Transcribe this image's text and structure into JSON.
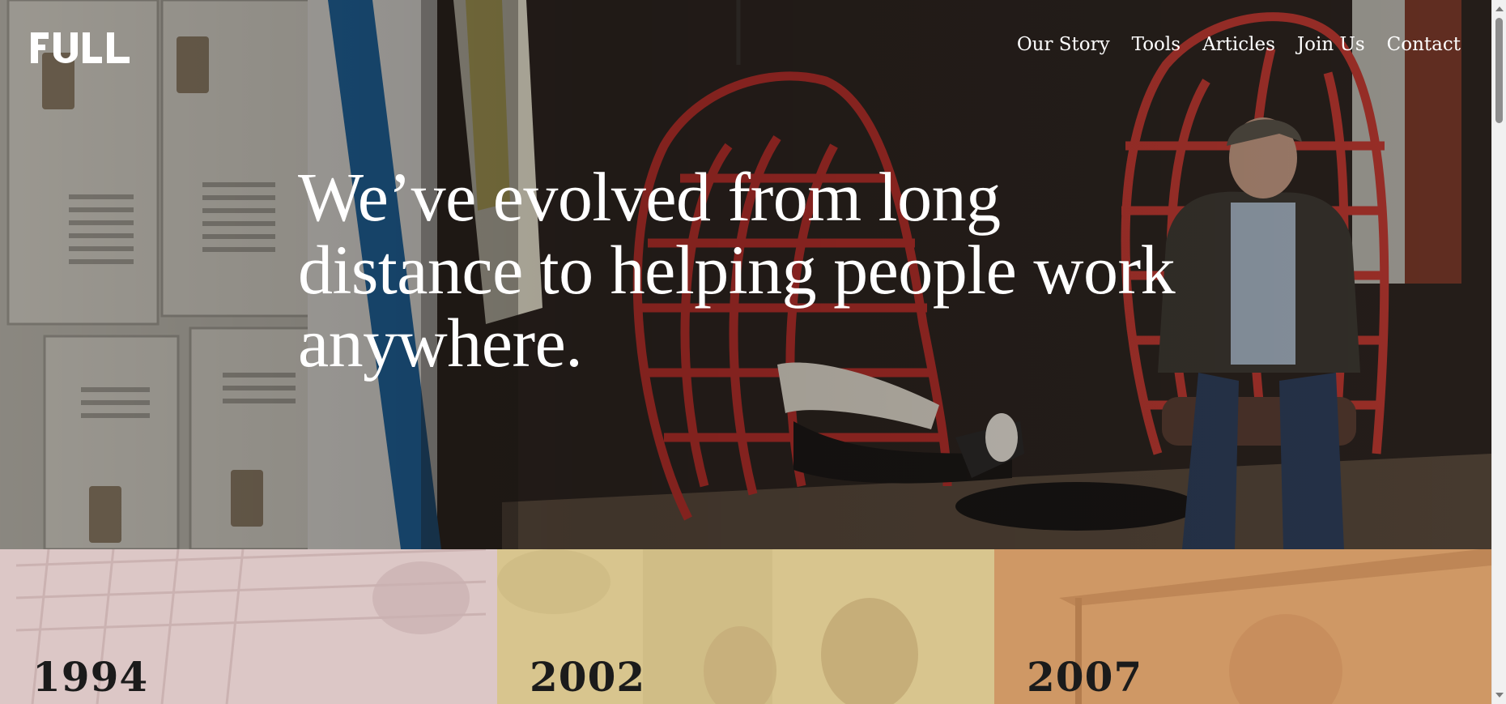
{
  "brand": {
    "logo_text": "FULL"
  },
  "nav": {
    "items": [
      {
        "label": "Our Story"
      },
      {
        "label": "Tools"
      },
      {
        "label": "Articles"
      },
      {
        "label": "Join Us"
      },
      {
        "label": "Contact"
      }
    ]
  },
  "hero": {
    "headline": "We’ve evolved from long distance to helping people work anywhere."
  },
  "timeline": {
    "cards": [
      {
        "year": "1994",
        "tint": "#d9c3c3"
      },
      {
        "year": "2002",
        "tint": "#d8c28a"
      },
      {
        "year": "2007",
        "tint": "#cf9560"
      }
    ]
  },
  "colors": {
    "hero_bg": "#2b241f",
    "chair_red": "#c4302b",
    "text_white": "#ffffff",
    "year_text": "#1b1b1b"
  },
  "icons": {
    "logo": "full-wordmark-icon",
    "scroll_up": "chevron-up-icon",
    "scroll_down": "chevron-down-icon"
  }
}
